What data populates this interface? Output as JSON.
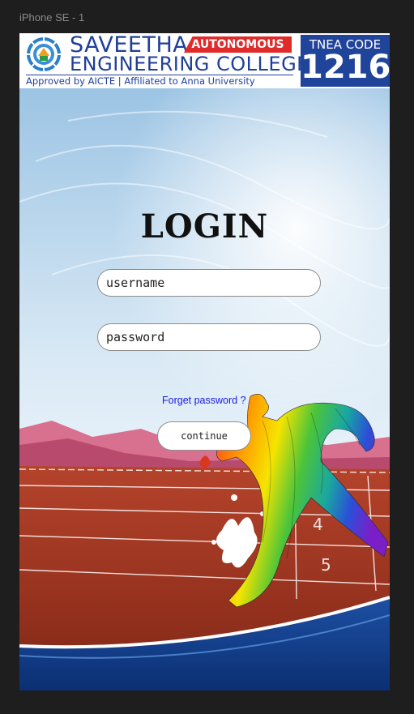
{
  "artboard": {
    "label": "iPhone SE - 1"
  },
  "header": {
    "college_line1": "SAVEETHA",
    "badge": "AUTONOMOUS",
    "college_line2": "ENGINEERING COLLEGE",
    "approval": "Approved by AICTE  |  Affiliated to Anna University",
    "tnea_label": "TNEA CODE",
    "tnea_code": "1216"
  },
  "login": {
    "title": "LOGIN",
    "username_placeholder": "username",
    "password_placeholder": "password",
    "forget_link": "Forget password ?",
    "continue_label": "continue"
  },
  "colors": {
    "brand_blue": "#1f3f99",
    "badge_red": "#e12a2a",
    "link_blue": "#1a1ae6",
    "track_red": "#a63a25"
  },
  "icons": {
    "logo": "college-seal-icon",
    "runner": "runner-illustration"
  }
}
